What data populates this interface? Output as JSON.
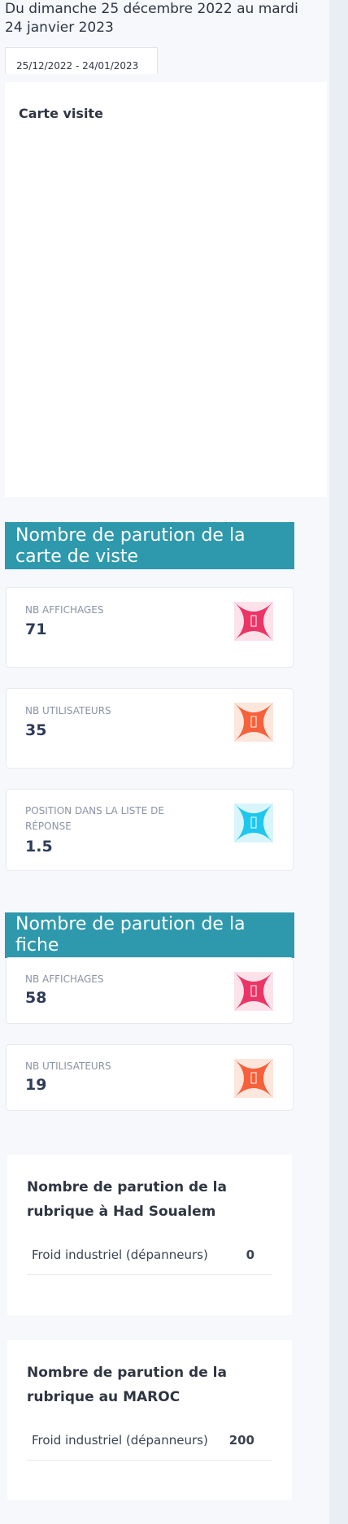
{
  "header": {
    "period_text": "Du dimanche 25 décembre 2022 au mardi 24 janvier 2023",
    "date_range_value": "25/12/2022 - 24/01/2023"
  },
  "carte_visite": {
    "title": "Carte visite"
  },
  "section_carte": {
    "title": "Nombre de parution de la carte de viste",
    "stats": [
      {
        "label": "NB AFFICHAGES",
        "value": "71",
        "icon": "eye-icon",
        "color": "#ec3567"
      },
      {
        "label": "NB UTILISATEURS",
        "value": "35",
        "icon": "users-icon",
        "color": "#f6603a"
      },
      {
        "label": "POSITION DANS LA LISTE DE RÉPONSE",
        "value": "1.5",
        "icon": "list-icon",
        "color": "#1ec7ee"
      }
    ]
  },
  "section_fiche": {
    "title": "Nombre de parution de la fiche",
    "stats": [
      {
        "label": "NB AFFICHAGES",
        "value": "58",
        "icon": "eye-icon",
        "color": "#ec3567"
      },
      {
        "label": "NB UTILISATEURS",
        "value": "19",
        "icon": "users-icon",
        "color": "#f6603a"
      }
    ]
  },
  "rubrique_local": {
    "title": "Nombre de parution de la rubrique à Had Soualem",
    "rows": [
      {
        "name": "Froid industriel (dépanneurs)",
        "count": "0"
      }
    ]
  },
  "rubrique_maroc": {
    "title": "Nombre de parution de la rubrique au MAROC",
    "rows": [
      {
        "name": "Froid industriel (dépanneurs)",
        "count": "200"
      }
    ]
  }
}
